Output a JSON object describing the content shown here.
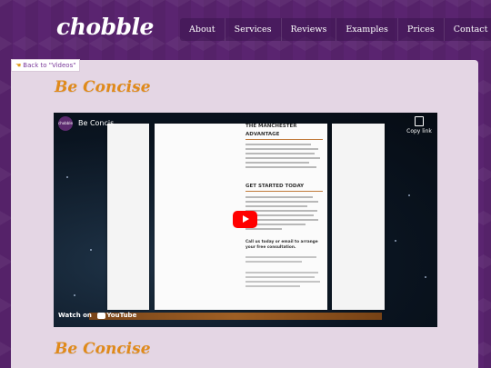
{
  "header": {
    "logo": "chobble",
    "nav": [
      "About",
      "Services",
      "Reviews",
      "Examples",
      "Prices",
      "Contact"
    ]
  },
  "back_link": "Back to \"Videos\"",
  "page_title": "Be Concise",
  "video": {
    "channel_logo": "chobble",
    "title": "Be Concis",
    "copy_link": "Copy link",
    "watch_on": "Watch on",
    "youtube": "YouTube",
    "doc": {
      "heading1": "THE MANCHESTER",
      "heading1b": "ADVANTAGE",
      "heading2": "GET STARTED TODAY",
      "cta": "Call us today or email to arrange your free consultation."
    }
  },
  "section_title_2": "Be Concise",
  "colors": {
    "accent": "#e08a1a",
    "background": "#5a2470",
    "card": "#e4d6e4",
    "play": "#ff0000"
  }
}
